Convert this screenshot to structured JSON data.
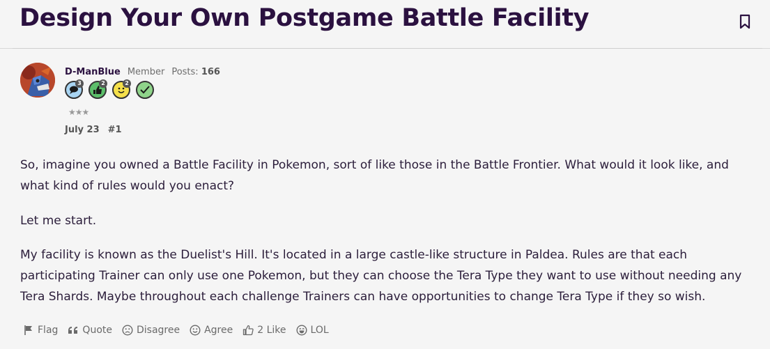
{
  "thread": {
    "title": "Design Your Own Postgame Battle Facility"
  },
  "post": {
    "author": "D-ManBlue",
    "role": "Member",
    "posts_label": "Posts:",
    "posts_count": "166",
    "badges": [
      {
        "icon": "speech-bubble-icon",
        "count": "3",
        "color": "#a8d4f2"
      },
      {
        "icon": "thumbs-up-icon",
        "count": "2",
        "color": "#5cbf6a"
      },
      {
        "icon": "smiley-icon",
        "count": "2",
        "color": "#f5e04a"
      },
      {
        "icon": "checkmark-icon",
        "count": "",
        "color": "#8fd48a"
      }
    ],
    "stars": "★★★",
    "date": "July 23",
    "post_number": "#1",
    "paragraphs": [
      "So, imagine you owned a Battle Facility in Pokemon, sort of like those in the Battle Frontier. What would it look like, and what kind of rules would you enact?",
      "Let me start.",
      "My facility is known as the Duelist's Hill. It's located in a large castle-like structure in Paldea. Rules are that each participating Trainer can only use one Pokemon, but they can choose the Tera Type they want to use without needing any Tera Shards. Maybe throughout each challenge Trainers can have opportunities to change Tera Type if they so wish."
    ],
    "actions": {
      "flag": "Flag",
      "quote": "Quote",
      "disagree": "Disagree",
      "agree": "Agree",
      "like": "2 Like",
      "lol": "LOL"
    }
  }
}
